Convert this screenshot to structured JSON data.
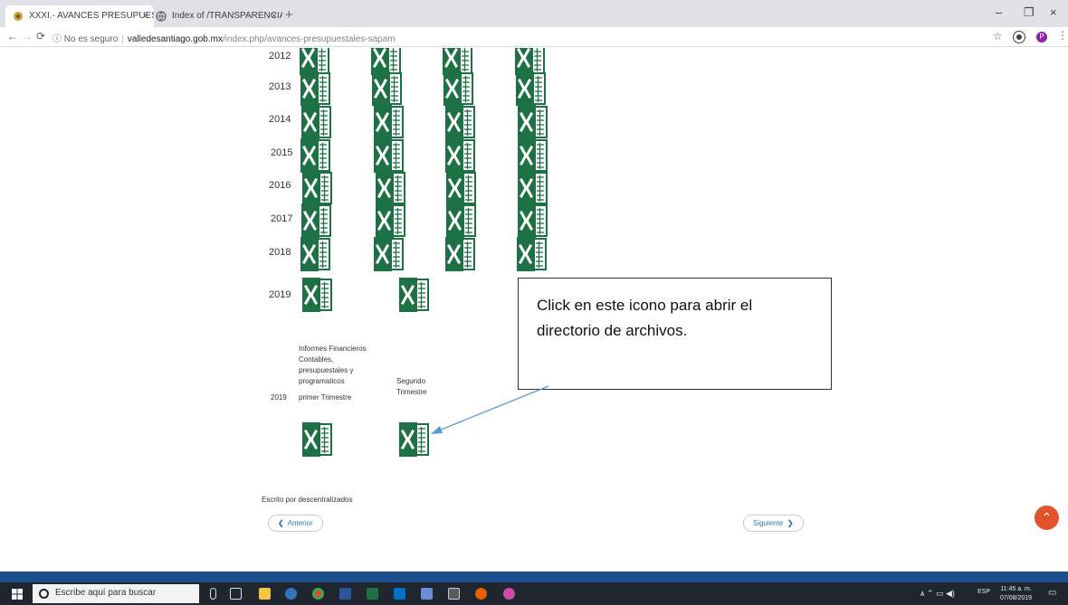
{
  "browser": {
    "tabs": [
      {
        "title": "XXXI.- AVANCES PRESUPUESTAL..."
      },
      {
        "title": "Index of /TRANSPARENCIA/CON..."
      }
    ],
    "tab_close": "×",
    "new_tab": "+",
    "security_label": "No es seguro",
    "url_host": "valledesantiago.gob.mx",
    "url_path": "/index.php/avances-presupuestales-sapam",
    "window_controls": [
      "–",
      "❐",
      "×"
    ],
    "profile_initial": "P"
  },
  "page": {
    "years": [
      "2012",
      "2013",
      "2014",
      "2015",
      "2016",
      "2017",
      "2018",
      "2019"
    ],
    "section_label": "Informes Financieros Contables, presupuestales y programaticos",
    "row2019": {
      "year": "2019",
      "q1": "primer Trimestre",
      "q2": "Segundo Trimestre"
    },
    "callout_text": "Click en este icono para abrir el directorio de archivos.",
    "pagination": {
      "prev": "Anterior",
      "next": "Siguiente"
    },
    "footer": "Escrito por descentralizados"
  },
  "taskbar": {
    "search_placeholder": "Escribe aquí para buscar",
    "lang": "ESP",
    "time": "11:45 a. m.",
    "date": "07/08/2019"
  },
  "colors": {
    "excel_green": "#1e7145",
    "callout_arrow": "#5b9bd5",
    "scroll_top": "#e2522b",
    "taskbar": "#1f2630"
  }
}
